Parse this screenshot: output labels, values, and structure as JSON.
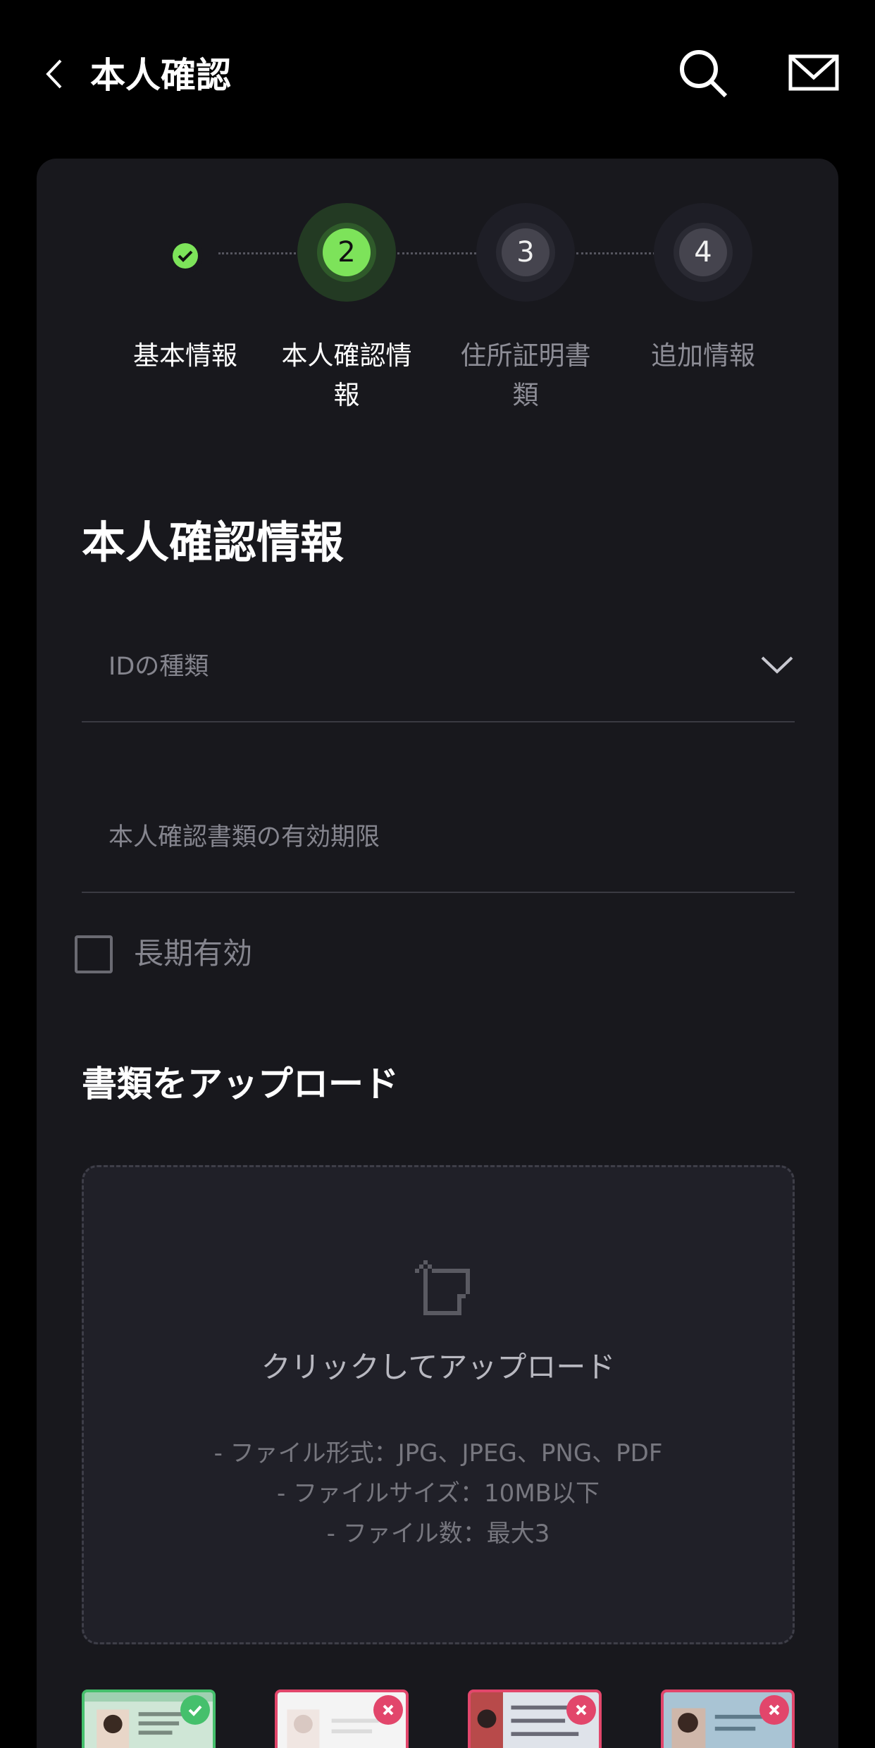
{
  "header": {
    "title": "本人確認",
    "back_icon": "chevron-left-icon",
    "search_icon": "search-icon",
    "mail_icon": "mail-icon"
  },
  "stepper": {
    "steps": [
      {
        "number": "",
        "label": "基本情報",
        "state": "done"
      },
      {
        "number": "2",
        "label": "本人確認情報",
        "state": "active"
      },
      {
        "number": "3",
        "label": "住所証明書類",
        "state": "todo"
      },
      {
        "number": "4",
        "label": "追加情報",
        "state": "todo"
      }
    ]
  },
  "form": {
    "section_title": "本人確認情報",
    "id_type": {
      "placeholder": "IDの種類",
      "value": ""
    },
    "expiry": {
      "placeholder": "本人確認書類の有効期限",
      "value": ""
    },
    "long_term": {
      "label": "長期有効",
      "checked": false
    }
  },
  "upload": {
    "title": "書類をアップロード",
    "cta": "クリックしてアップロード",
    "rule_format": "- ファイル形式：JPG、JPEG、PNG、PDF",
    "rule_size": "- ファイルサイズ：10MB以下",
    "rule_count": "- ファイル数：最大3"
  },
  "examples": [
    {
      "status": "ok"
    },
    {
      "status": "bad"
    },
    {
      "status": "bad"
    },
    {
      "status": "bad"
    }
  ],
  "colors": {
    "accent": "#7de35a",
    "ok": "#45c06c",
    "error": "#e2466b",
    "card": "#18181d",
    "background": "#000000"
  }
}
